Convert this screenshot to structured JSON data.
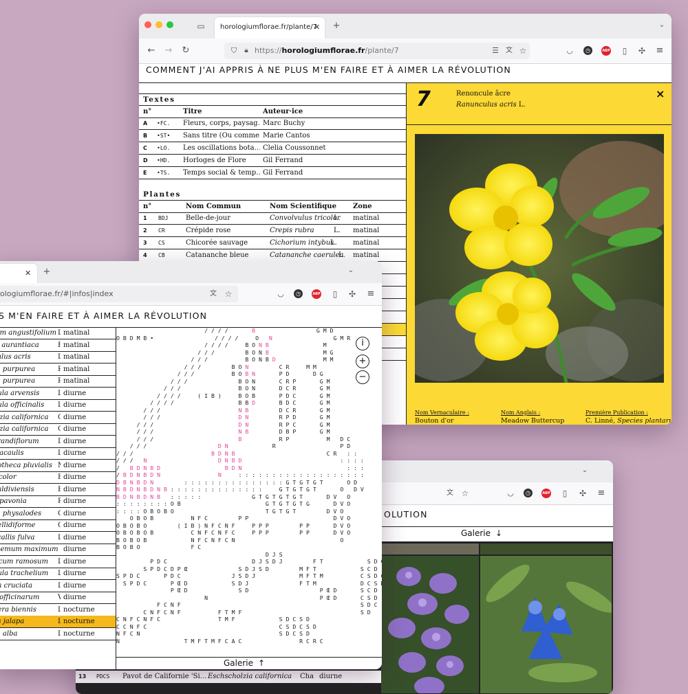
{
  "site_title": "COMMENT J'AI APPRIS À NE PLUS M'EN FAIRE ET À AIMER LA RÉVOLUTION",
  "site_title_cut": "S M'EN FAIRE ET À AIMER LA RÉVOLUTION",
  "site_title_cut3": "OLUTION",
  "win1": {
    "tab_title": "horologiumflorae.fr/plante/7",
    "url_prefix": "https://",
    "url_domain": "horologiumflorae.fr",
    "url_path": "/plante/7",
    "textes": {
      "heading": "Textes",
      "columns": [
        "n°",
        "Titre",
        "Auteur·ice"
      ],
      "rows": [
        {
          "n": "A",
          "code": "•FC.",
          "titre": "Fleurs, corps, paysag…",
          "auteur": "Marc Buchy"
        },
        {
          "n": "B",
          "code": "•ST•",
          "titre": "Sans titre (Ou comme…",
          "auteur": "Marie Cantos"
        },
        {
          "n": "C",
          "code": "•LO.",
          "titre": "Les oscillations bota…",
          "auteur": "Clelia Coussonnet"
        },
        {
          "n": "D",
          "code": "•HD.",
          "titre": "Horloges de Flore",
          "auteur": "Gil Ferrand"
        },
        {
          "n": "E",
          "code": "•TS.",
          "titre": "Temps social & temp…",
          "auteur": "Gil Ferrand"
        }
      ]
    },
    "plantes": {
      "heading": "Plantes",
      "columns": [
        "n°",
        "Nom Commun",
        "Nom Scientifique",
        "Zone"
      ],
      "rows": [
        {
          "n": "1",
          "code": "BDJ",
          "commun": "Belle-de-jour",
          "sci": "Convolvulus tricolor",
          "auth": "L.",
          "zone": "matinal"
        },
        {
          "n": "2",
          "code": "CR",
          "commun": "Crépide rose",
          "sci": "Crepis rubra",
          "auth": "L.",
          "zone": "matinal"
        },
        {
          "n": "3",
          "code": "CS",
          "commun": "Chicorée sauvage",
          "sci": "Cichorium intybus",
          "auth": "L.",
          "zone": "matinal"
        },
        {
          "n": "4",
          "code": "CB",
          "commun": "Catananche bleue",
          "sci": "Catananche caerulea",
          "auth": "L.",
          "zone": "matinal"
        }
      ]
    },
    "plant_panel": {
      "number": "7",
      "common_name": "Renoncule âcre",
      "sci_name": "Ranunculus acris",
      "sci_author": "L.",
      "close": "×",
      "fields": [
        {
          "label": "Nom Vernaculaire :",
          "value": "Bouton d'or",
          "value_italic": ""
        },
        {
          "label": "Nom Anglais :",
          "value": "Meadow Buttercup",
          "value_italic": ""
        },
        {
          "label": "Première Publication :",
          "value": "C. Linné, ",
          "value_italic": "Species plantarum,"
        }
      ]
    }
  },
  "win2": {
    "url": "ologiumflorae.fr/#|infos|index",
    "gallery_label": "Galerie",
    "gallery_arrow": "↑",
    "zoom_info": "i",
    "zoom_in": "+",
    "zoom_out": "−",
    "plants": [
      {
        "sci": "ium angustifolium",
        "auth": "L.",
        "zone": "matinal"
      },
      {
        "sci": "la aurantiaca",
        "auth": "F.W.Sch",
        "zone": "matinal"
      },
      {
        "sci": "culus acris",
        "auth": "L.",
        "zone": "matinal"
      },
      {
        "sci": "ra purpurea",
        "auth": "Roth",
        "zone": "matinal"
      },
      {
        "sci": "ra purpurea",
        "auth": "Roth",
        "zone": "matinal"
      },
      {
        "sci": "dula arvensis",
        "auth": "L.",
        "zone": "diurne"
      },
      {
        "sci": "dula officinalis",
        "auth": "L.",
        "zone": "diurne"
      },
      {
        "sci": "olzia californica",
        "auth": "Cha",
        "zone": "diurne"
      },
      {
        "sci": "olzia californica",
        "auth": "Cha",
        "zone": "diurne"
      },
      {
        "sci": "grandiflorum",
        "auth": "Desf.",
        "zone": "diurne"
      },
      {
        "sci": "a acaulis",
        "auth": "L.",
        "zone": "diurne"
      },
      {
        "sci": "hotheca pluvialis",
        "auth": "M",
        "zone": "diurne"
      },
      {
        "sci": "ricolor",
        "auth": "Benth.",
        "zone": "diurne"
      },
      {
        "sci": "Valdiviensis",
        "auth": "Barnéou",
        "zone": "diurne"
      },
      {
        "sci": "a pavonia",
        "auth": "Redouté",
        "zone": "diurne"
      },
      {
        "sci": "ra physalodes",
        "auth": "Ga",
        "zone": "diurne"
      },
      {
        "sci": "bellidiforme",
        "auth": "G.",
        "zone": "diurne"
      },
      {
        "sci": "ocallis fulva",
        "auth": "L.",
        "zone": "diurne"
      },
      {
        "sci": "themum maximum",
        "auth": "",
        "zone": "diurne"
      },
      {
        "sci": "ricum ramosum",
        "auth": "L.",
        "zone": "diurne"
      },
      {
        "sci": "nula trachelium",
        "auth": "L.",
        "zone": "diurne"
      },
      {
        "sci": "na cruciata",
        "auth": "L.",
        "zone": "diurne"
      },
      {
        "sci": "a officinarum",
        "auth": "Vaill.",
        "zone": "diurne"
      },
      {
        "sci": "hera biennis",
        "auth": "L.",
        "zone": "nocturne"
      },
      {
        "sci": "lis jalapa",
        "auth": "L.",
        "zone": "nocturne"
      },
      {
        "sci": "ra alba",
        "auth": "L.",
        "zone": "nocturne"
      }
    ]
  },
  "win3": {
    "gallery_label": "Galerie",
    "gallery_arrow": "↓",
    "bottom_row": {
      "n": "13",
      "code": "PDCS",
      "commun": "Pavot de Californie 'Si…",
      "sci": "Eschscholzia californica",
      "auth": "Cha",
      "zone": "diurne"
    }
  },
  "colors": {
    "accent_yellow": "#fdd935",
    "highlight_orange": "#f5b81c",
    "pink": "#e3479e",
    "backdrop": "#c7a8c0"
  }
}
